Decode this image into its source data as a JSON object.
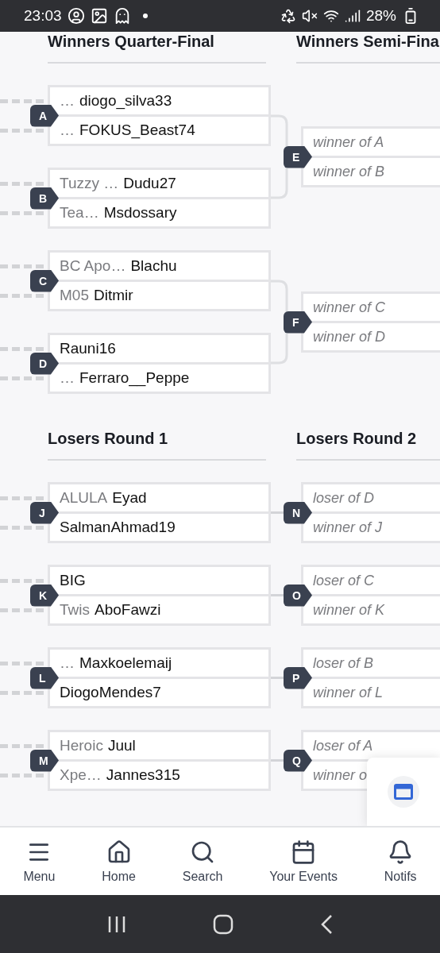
{
  "status_bar": {
    "time": "23:03",
    "battery": "28%"
  },
  "sections": [
    {
      "headers": [
        "Winners Quarter-Final",
        "Winners Semi-Fina"
      ],
      "groups": [
        {
          "left": [
            {
              "label": "A",
              "slots": [
                {
                  "kind": "player",
                  "tag": "…",
                  "name": "diogo_silva33"
                },
                {
                  "kind": "player",
                  "tag": "…",
                  "name": "FOKUS_Beast74"
                }
              ]
            },
            {
              "label": "B",
              "slots": [
                {
                  "kind": "player",
                  "tag": "Tuzzy …",
                  "name": "Dudu27"
                },
                {
                  "kind": "player",
                  "tag": "Tea…",
                  "name": "Msdossary"
                }
              ]
            }
          ],
          "right": {
            "label": "E",
            "slots": [
              {
                "kind": "pending",
                "text": "winner of A"
              },
              {
                "kind": "pending",
                "text": "winner of B"
              }
            ]
          }
        },
        {
          "left": [
            {
              "label": "C",
              "slots": [
                {
                  "kind": "player",
                  "tag": "BC Apo…",
                  "name": "Blachu"
                },
                {
                  "kind": "player",
                  "tag": "M05",
                  "name": "Ditmir"
                }
              ]
            },
            {
              "label": "D",
              "slots": [
                {
                  "kind": "player",
                  "name": "Rauni16"
                },
                {
                  "kind": "player",
                  "tag": "…",
                  "name": "Ferraro__Peppe"
                }
              ]
            }
          ],
          "right": {
            "label": "F",
            "slots": [
              {
                "kind": "pending",
                "text": "winner of C"
              },
              {
                "kind": "pending",
                "text": "winner of D"
              }
            ]
          }
        }
      ]
    },
    {
      "headers": [
        "Losers Round 1",
        "Losers Round 2"
      ],
      "groups": [
        {
          "left": [
            {
              "label": "J",
              "slots": [
                {
                  "kind": "player",
                  "tag": "ALULA",
                  "name": "Eyad"
                },
                {
                  "kind": "player",
                  "name": "SalmanAhmad19"
                }
              ]
            }
          ],
          "right": {
            "label": "N",
            "slots": [
              {
                "kind": "pending",
                "text": "loser of D"
              },
              {
                "kind": "pending",
                "text": "winner of J"
              }
            ]
          }
        },
        {
          "left": [
            {
              "label": "K",
              "slots": [
                {
                  "kind": "player",
                  "name": "BIG"
                },
                {
                  "kind": "player",
                  "tag": "Twis",
                  "name": "AboFawzi"
                }
              ]
            }
          ],
          "right": {
            "label": "O",
            "slots": [
              {
                "kind": "pending",
                "text": "loser of C"
              },
              {
                "kind": "pending",
                "text": "winner of K"
              }
            ]
          }
        },
        {
          "left": [
            {
              "label": "L",
              "slots": [
                {
                  "kind": "player",
                  "tag": "…",
                  "name": "Maxkoelemaij"
                },
                {
                  "kind": "player",
                  "name": "DiogoMendes7"
                }
              ]
            }
          ],
          "right": {
            "label": "P",
            "slots": [
              {
                "kind": "pending",
                "text": "loser of B"
              },
              {
                "kind": "pending",
                "text": "winner of L"
              }
            ]
          }
        },
        {
          "left": [
            {
              "label": "M",
              "slots": [
                {
                  "kind": "player",
                  "tag": "Heroic",
                  "name": "Juul"
                },
                {
                  "kind": "player",
                  "tag": "Xpe…",
                  "name": "Jannes315"
                }
              ]
            }
          ],
          "right": {
            "label": "Q",
            "slots": [
              {
                "kind": "pending",
                "text": "loser of A"
              },
              {
                "kind": "pending",
                "text": "winner o"
              }
            ]
          }
        }
      ]
    }
  ],
  "bottom_nav": [
    {
      "kind": "menu",
      "label": "Menu"
    },
    {
      "kind": "home",
      "label": "Home"
    },
    {
      "kind": "search",
      "label": "Search"
    },
    {
      "kind": "events",
      "label": "Your Events"
    },
    {
      "kind": "notifs",
      "label": "Notifs"
    }
  ]
}
